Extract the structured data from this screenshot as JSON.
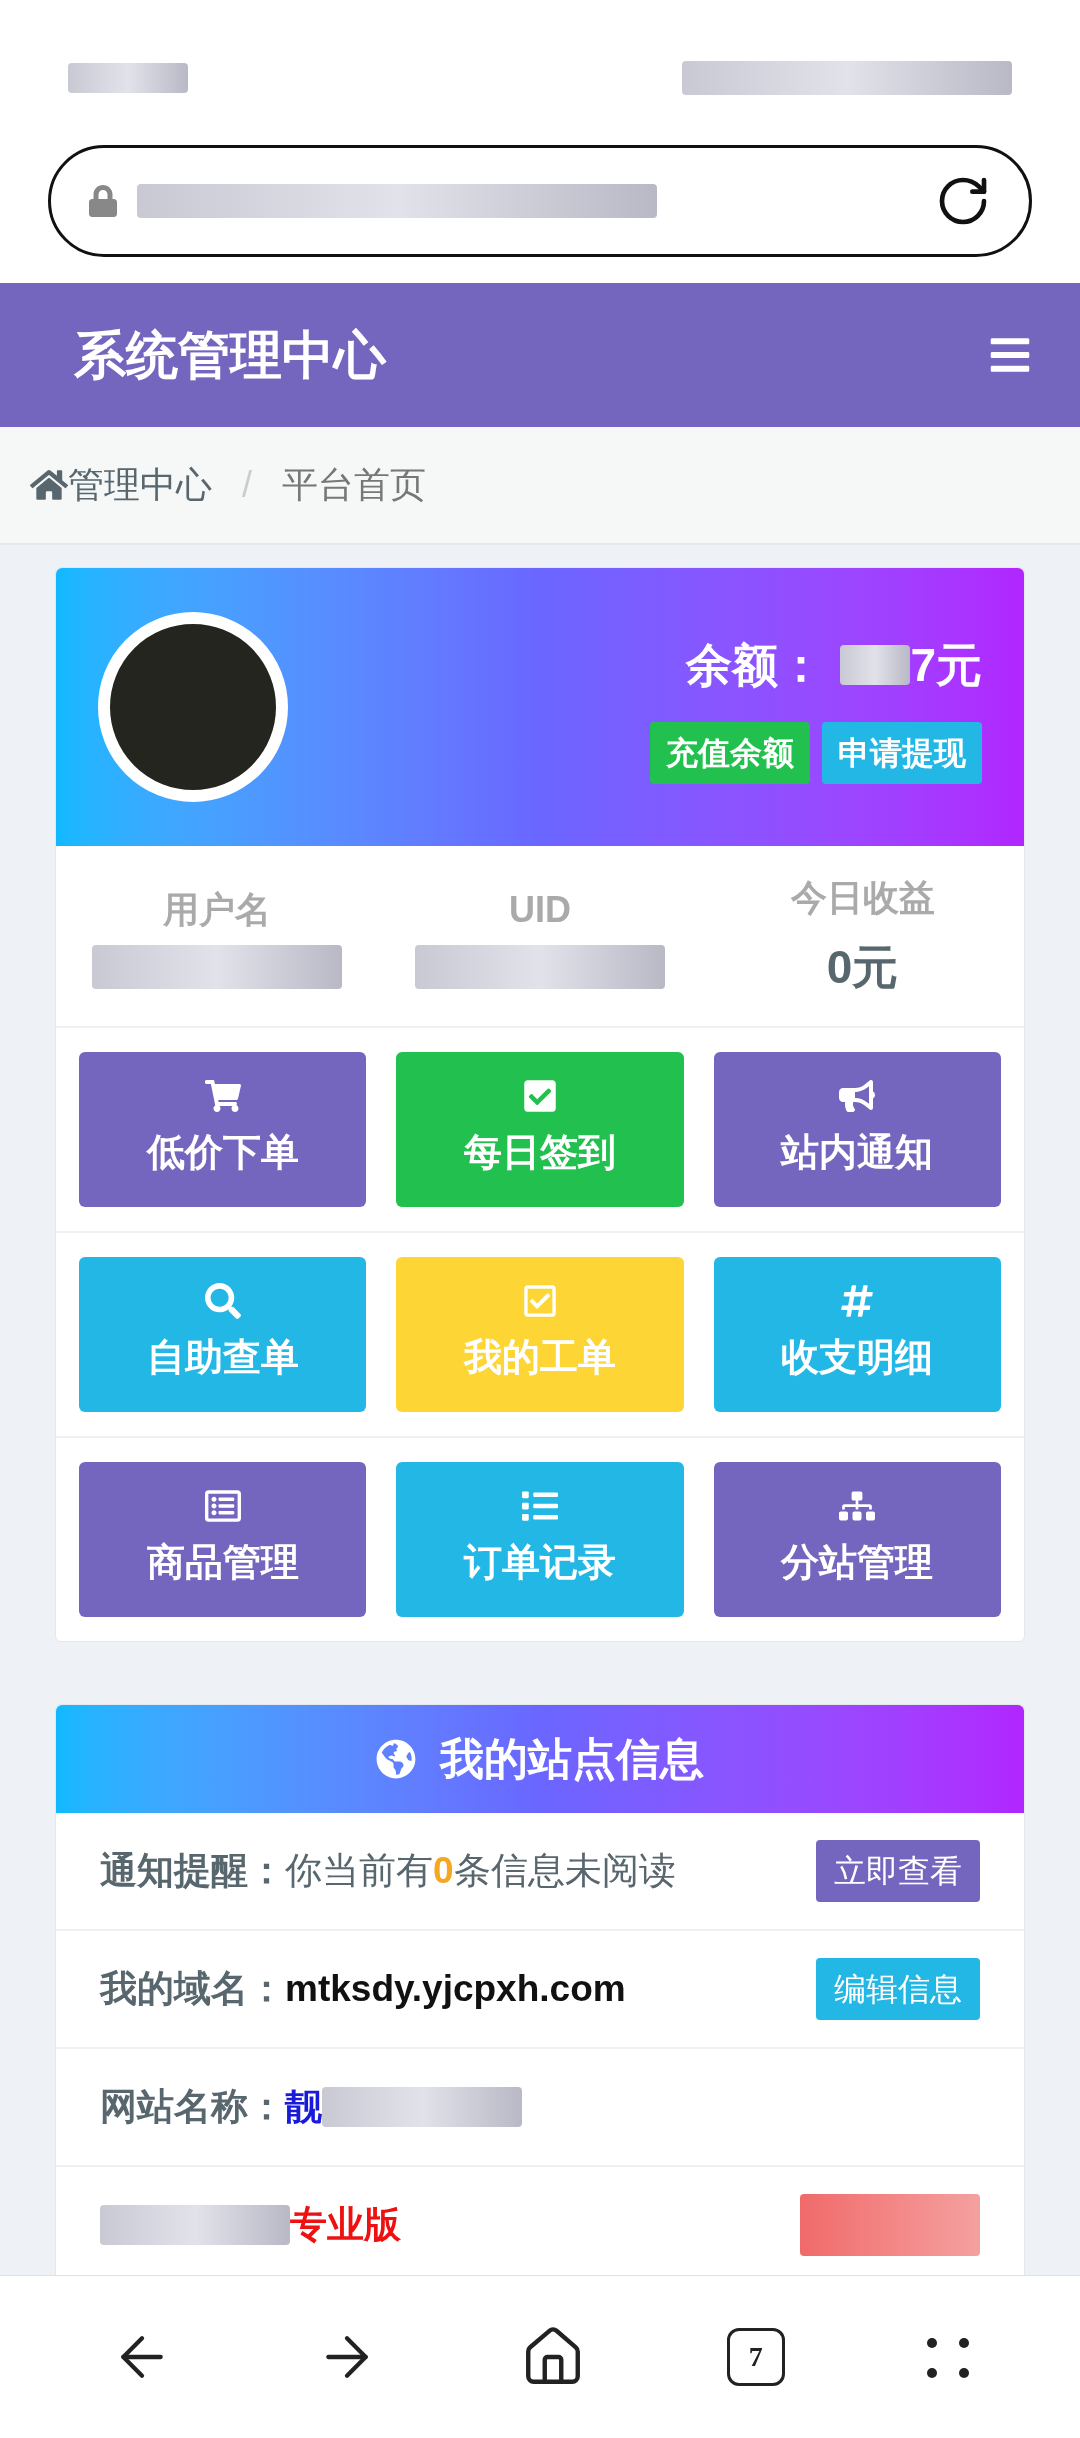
{
  "header": {
    "title": "系统管理中心"
  },
  "breadcrumb": [
    {
      "label": "管理中心"
    },
    {
      "label": "平台首页"
    }
  ],
  "breadcrumb_separator": "/",
  "profile": {
    "balance_label": "余额：",
    "balance_value": "7元",
    "buttons": [
      {
        "label": "充值余额",
        "color": "#22c04f"
      },
      {
        "label": "申请提现",
        "color": "#23b7e5"
      }
    ]
  },
  "stats": [
    {
      "label": "用户名"
    },
    {
      "label": "UID"
    },
    {
      "label": "今日收益",
      "value": "0元"
    }
  ],
  "tiles": [
    {
      "label": "低价下单",
      "color": "#7466be"
    },
    {
      "label": "每日签到",
      "color": "#22c04f"
    },
    {
      "label": "站内通知",
      "color": "#7466be"
    },
    {
      "label": "自助查单",
      "color": "#23b7e5"
    },
    {
      "label": "我的工单",
      "color": "#fdd535"
    },
    {
      "label": "收支明细",
      "color": "#23b7e5"
    },
    {
      "label": "商品管理",
      "color": "#7466be"
    },
    {
      "label": "订单记录",
      "color": "#23b7e5"
    },
    {
      "label": "分站管理",
      "color": "#7466be"
    }
  ],
  "site_info": {
    "title": "我的站点信息",
    "rows": [
      {
        "kind": "notice",
        "label": "通知提醒：",
        "value": "你当前有**0**条信息未阅读",
        "button": {
          "label": "立即查看",
          "color": "#7466be"
        }
      },
      {
        "kind": "domain",
        "label": "我的域名：",
        "value": "mtksdy.yjcpxh.com",
        "button": {
          "label": "编辑信息",
          "color": "#23b7e5"
        }
      },
      {
        "kind": "name",
        "value": "靓",
        "label": "网站名称："
      },
      {
        "kind": "type",
        "value": "专业版"
      }
    ]
  },
  "bottom_bar": {
    "tab_count": "7"
  }
}
